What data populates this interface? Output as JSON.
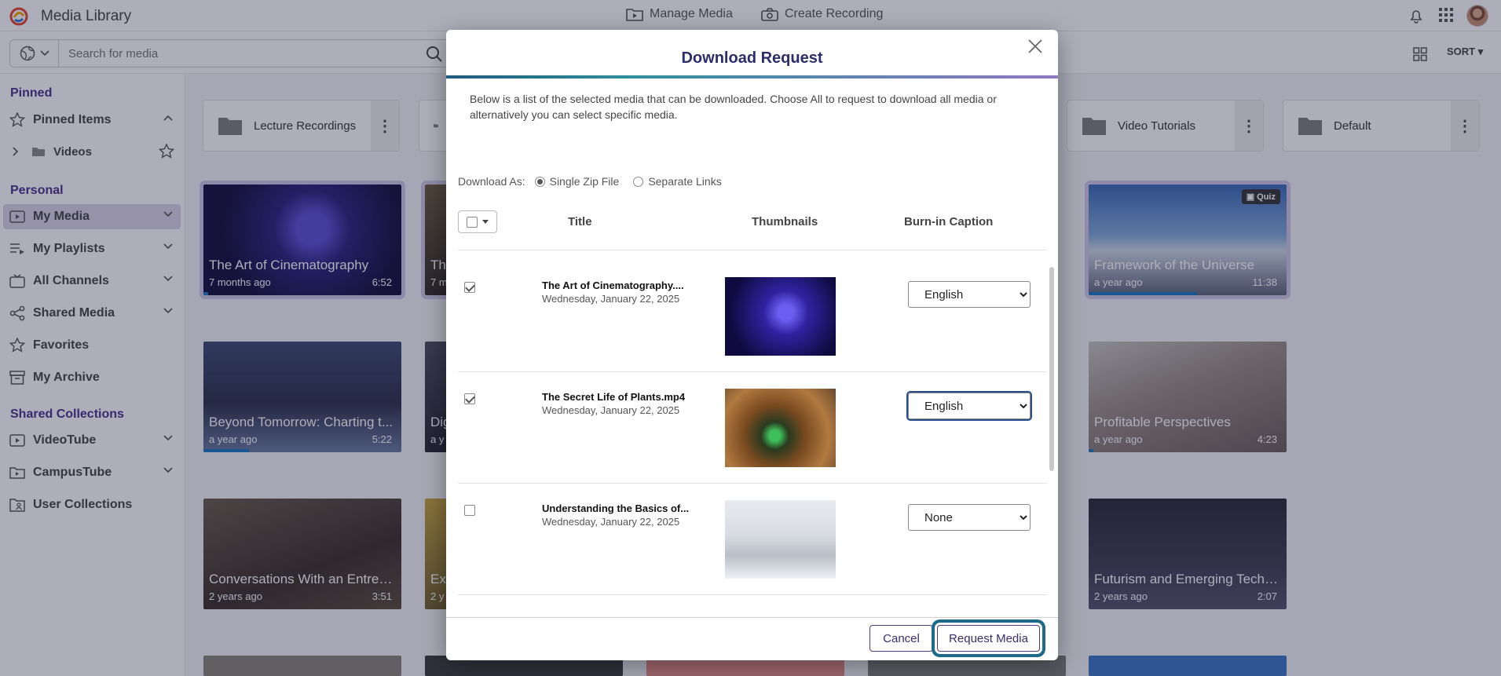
{
  "app": {
    "title": "Media Library"
  },
  "topnav": {
    "manage_media": "Manage Media",
    "create_recording": "Create Recording"
  },
  "search": {
    "placeholder": "Search for media"
  },
  "toolbar": {
    "sort_label": "SORT"
  },
  "sidebar": {
    "pinned_heading": "Pinned",
    "pinned_items": "Pinned Items",
    "videos": "Videos",
    "personal_heading": "Personal",
    "items": [
      {
        "label": "My Media",
        "icon": "media-icon"
      },
      {
        "label": "My Playlists",
        "icon": "playlist-icon"
      },
      {
        "label": "All Channels",
        "icon": "channels-icon"
      },
      {
        "label": "Shared Media",
        "icon": "share-icon"
      },
      {
        "label": "Favorites",
        "icon": "star-icon"
      },
      {
        "label": "My Archive",
        "icon": "archive-icon"
      }
    ],
    "shared_heading": "Shared Collections",
    "shared_items": [
      {
        "label": "VideoTube"
      },
      {
        "label": "CampusTube"
      },
      {
        "label": "User Collections"
      }
    ]
  },
  "folders": [
    {
      "label": "Lecture Recordings"
    },
    {
      "label": "Video Tutorials"
    },
    {
      "label": "Default"
    }
  ],
  "cards": [
    {
      "title": "The Art of Cinematography",
      "meta": "7 months ago",
      "duration": "6:52"
    },
    {
      "title": "Th",
      "meta": "7 m",
      "duration": ""
    },
    {
      "title": "Framework of the Universe",
      "meta": "a year ago",
      "duration": "11:38",
      "badge": "Quiz"
    },
    {
      "title": "Beyond Tomorrow: Charting t...",
      "meta": "a year ago",
      "duration": "5:22"
    },
    {
      "title": "Dig",
      "meta": "a y",
      "duration": ""
    },
    {
      "title": "Profitable Perspectives",
      "meta": "a year ago",
      "duration": "4:23"
    },
    {
      "title": "Conversations With an Entrep...",
      "meta": "2 years ago",
      "duration": "3:51"
    },
    {
      "title": "Ex",
      "meta": "2 y",
      "duration": ""
    },
    {
      "title": "Futurism and Emerging Techn...",
      "meta": "2 years ago",
      "duration": "2:07"
    }
  ],
  "modal": {
    "title": "Download Request",
    "description": "Below is a list of the selected media that can be downloaded. Choose All to request to download all media or alternatively you can select specific media.",
    "download_as_label": "Download As:",
    "option_zip": "Single Zip File",
    "option_links": "Separate Links",
    "selected_option": "Single Zip File",
    "col_title": "Title",
    "col_thumbnails": "Thumbnails",
    "col_caption": "Burn-in Caption",
    "rows": [
      {
        "title": "The Art of Cinematography....",
        "date": "Wednesday, January 22, 2025",
        "checked": true,
        "caption": "English"
      },
      {
        "title": "The Secret Life of Plants.mp4",
        "date": "Wednesday, January 22, 2025",
        "checked": true,
        "caption": "English"
      },
      {
        "title": "Understanding the Basics of...",
        "date": "Wednesday, January 22, 2025",
        "checked": false,
        "caption": "None"
      }
    ],
    "cancel_label": "Cancel",
    "request_label": "Request Media"
  },
  "colors": {
    "accent": "#4a2f8a",
    "focus_ring": "#1d6a8a",
    "title": "#2b2d6a"
  }
}
